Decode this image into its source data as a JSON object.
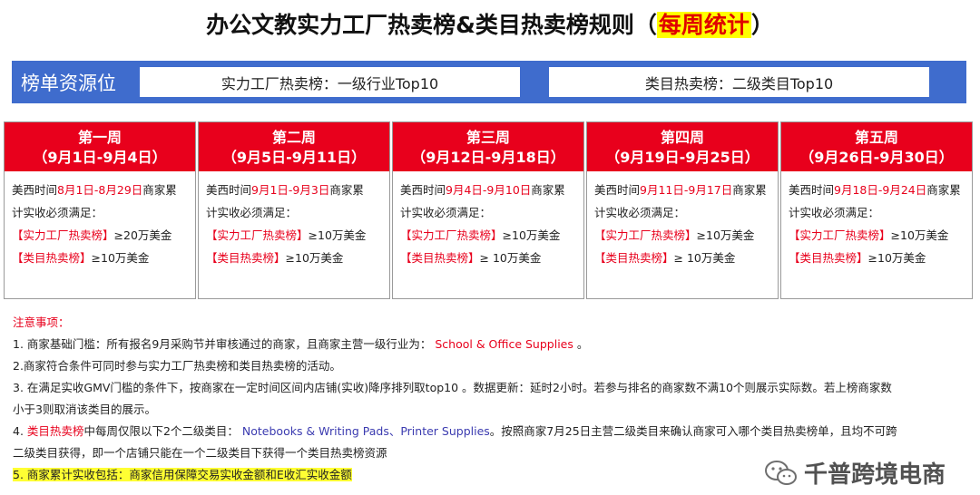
{
  "title": {
    "main": "办公文教实力工厂热卖榜&类目热卖榜规则（",
    "highlight": "每周统计",
    "tail": "）"
  },
  "resource_bar": {
    "label": "榜单资源位",
    "box1": "实力工厂热卖榜：一级行业Top10",
    "box2": "类目热卖榜：二级类目Top10"
  },
  "weeks": [
    {
      "name": "第一周",
      "range": "（9月1日-9月4日）",
      "time_prefix": "美西时间",
      "time_range": "8月1日-8月29日",
      "time_suffix": "商家累",
      "line2": "计实收必须满足：",
      "factory_label": "【实力工厂热卖榜】",
      "factory_req": "≥20万美金",
      "category_label": "【类目热卖榜】",
      "category_req": "≥10万美金"
    },
    {
      "name": "第二周",
      "range": "（9月5日-9月11日）",
      "time_prefix": "美西时间",
      "time_range": "9月1日-9月3日",
      "time_suffix": "商家累",
      "line2": "计实收必须满足：",
      "factory_label": "【实力工厂热卖榜】",
      "factory_req": "≥10万美金",
      "category_label": "【类目热卖榜】",
      "category_req": "≥10万美金"
    },
    {
      "name": "第三周",
      "range": "（9月12日-9月18日）",
      "time_prefix": "美西时间",
      "time_range": "9月4日-9月10日",
      "time_suffix": "商家累",
      "line2": "计实收必须满足：",
      "factory_label": "【实力工厂热卖榜】",
      "factory_req": "≥10万美金",
      "category_label": "【类目热卖榜】",
      "category_req": "≥ 10万美金"
    },
    {
      "name": "第四周",
      "range": "（9月19日-9月25日）",
      "time_prefix": "美西时间",
      "time_range": "9月11日-9月17日",
      "time_suffix": "商家累",
      "line2": "计实收必须满足：",
      "factory_label": "【实力工厂热卖榜】",
      "factory_req": "≥10万美金",
      "category_label": "【类目热卖榜】",
      "category_req": "≥ 10万美金"
    },
    {
      "name": "第五周",
      "range": "（9月26日-9月30日）",
      "time_prefix": "美西时间",
      "time_range": "9月18日-9月24日",
      "time_suffix": "商家累",
      "line2": "计实收必须满足：",
      "factory_label": "【实力工厂热卖榜】",
      "factory_req": "≥10万美金",
      "category_label": "【类目热卖榜】",
      "category_req": "≥10万美金"
    }
  ],
  "notes": {
    "title": "注意事项：",
    "n1_text": "1. 商家基础门槛：所有报名9月采购节并审核通过的商家，且商家主营一级行业为：",
    "n1_highlight": "School & Office Supplies",
    "n1_end": "。",
    "n2": "2.商家符合条件可同时参与实力工厂热卖榜和类目热卖榜的活动。",
    "n3_a": "3. 在满足实收GMV门槛的条件下，按商家在一定时间区间内店铺(实收)降序排列取top10 。数据更新：延时2小时。若参与排名的商家数不满10个则展示实际数。若上榜商家数",
    "n3_b": "小于3则取消该类目的展示。",
    "n4_prefix": "4.",
    "n4_red": "类目热卖榜",
    "n4_mid": "中每周仅限以下2个二级类目：",
    "n4_blue": "Notebooks & Writing Pads、Printer Supplies",
    "n4_rest": "。按照商家7月25日主营二级类目来确认商家可入哪个类目热卖榜单，且均不可跨",
    "n4_b": "二级类目获得，即一个店铺只能在一个二级类目下获得一个类目热卖榜资源",
    "n5": "5. 商家累计实收包括：商家信用保障交易实收金额和E收汇实收金额"
  },
  "watermark": {
    "text": "千普跨境电商",
    "icon": "wechat-icon"
  },
  "colors": {
    "accent_red": "#e8001c",
    "bar_blue": "#3f6ccd",
    "highlight_yellow": "#ffff00"
  }
}
